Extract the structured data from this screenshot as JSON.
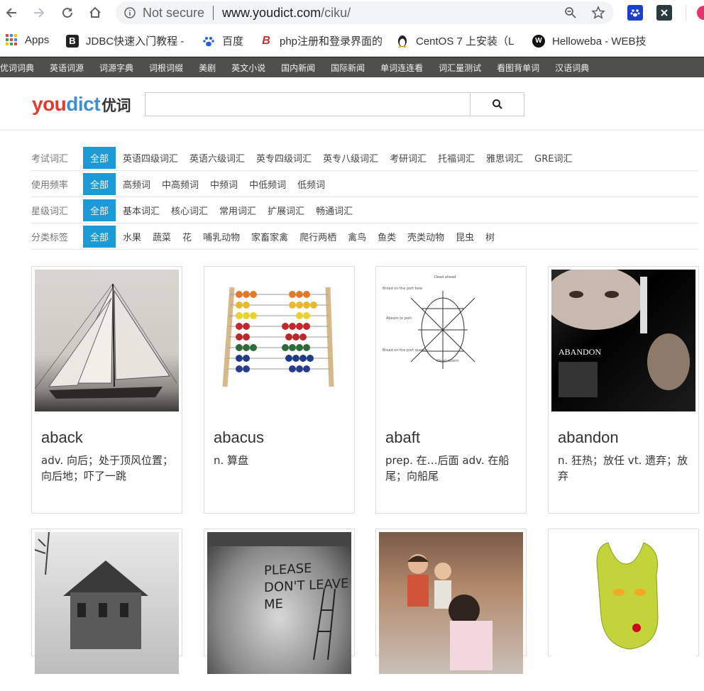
{
  "browser": {
    "secure_label": "Not secure",
    "url_host": "www.youdict.com",
    "url_path": "/ciku/"
  },
  "bookmarks": [
    {
      "label": "Apps"
    },
    {
      "label": "JDBC快速入门教程 -"
    },
    {
      "label": "百度"
    },
    {
      "label": "php注册和登录界面的"
    },
    {
      "label": "CentOS 7 上安装（L"
    },
    {
      "label": "Helloweba - WEB技"
    }
  ],
  "topnav": [
    "优词词典",
    "英语词源",
    "词源字典",
    "词根词缀",
    "美剧",
    "英文小说",
    "国内新闻",
    "国际新闻",
    "单词连连看",
    "词汇量测试",
    "看图背单词",
    "汉语词典"
  ],
  "logo": {
    "you": "you",
    "dict": "dict",
    "cn": "优词"
  },
  "search": {
    "placeholder": ""
  },
  "filters": [
    {
      "label": "考试词汇",
      "all": "全部",
      "tags": [
        "英语四级词汇",
        "英语六级词汇",
        "英专四级词汇",
        "英专八级词汇",
        "考研词汇",
        "托福词汇",
        "雅思词汇",
        "GRE词汇"
      ]
    },
    {
      "label": "使用频率",
      "all": "全部",
      "tags": [
        "高频词",
        "中高频词",
        "中频词",
        "中低频词",
        "低频词"
      ]
    },
    {
      "label": "星级词汇",
      "all": "全部",
      "tags": [
        "基本词汇",
        "核心词汇",
        "常用词汇",
        "扩展词汇",
        "畅通词汇"
      ]
    },
    {
      "label": "分类标签",
      "all": "全部",
      "tags": [
        "水果",
        "蔬菜",
        "花",
        "哺乳动物",
        "家畜家禽",
        "爬行两栖",
        "禽鸟",
        "鱼类",
        "壳类动物",
        "昆虫",
        "树"
      ]
    }
  ],
  "cards": [
    {
      "word": "aback",
      "def": "adv. 向后；处于顶风位置；向后地；吓了一跳"
    },
    {
      "word": "abacus",
      "def": "n. 算盘"
    },
    {
      "word": "abaft",
      "def": "prep. 在…后面 adv. 在船尾；向船尾"
    },
    {
      "word": "abandon",
      "def": "n. 狂热；放任 vt. 遗弃；放弃",
      "poster_title": "ABANDON"
    },
    {
      "word": "",
      "def": ""
    },
    {
      "word": "",
      "def": "",
      "poster_text": "PLEASE DON'T LEAVE ME"
    },
    {
      "word": "",
      "def": ""
    },
    {
      "word": "",
      "def": ""
    }
  ],
  "colors": {
    "accent": "#1b9ad6",
    "nav_bg": "#4f4f4c",
    "logo_red": "#e03b2c",
    "logo_blue": "#3d8fd1"
  }
}
